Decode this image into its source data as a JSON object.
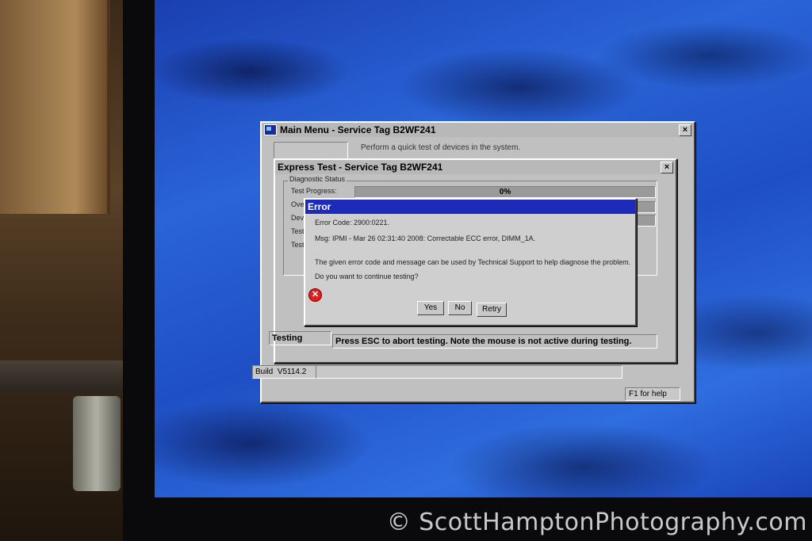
{
  "main_menu": {
    "title": "Main Menu - Service Tag B2WF241",
    "close": "×",
    "description": "Perform a quick test of devices in the system.",
    "status_left": "Build",
    "build_version": "V5114.2",
    "help_hint": "F1 for help"
  },
  "express_test": {
    "title": "Express Test - Service Tag B2WF241",
    "close": "×",
    "group_label": "Diagnostic Status",
    "rows": [
      "Test Progress:",
      "Ove",
      "Dev",
      "Test",
      "Test"
    ],
    "progress_text": "0%",
    "progress": 0,
    "status": "Testing",
    "hint": "Press ESC to abort testing.  Note the mouse is not active during testing."
  },
  "error_dialog": {
    "title": "Error",
    "error_code": "Error Code: 2900:0221.",
    "message": "Msg: IPMI - Mar 26 02:31:40 2008: Correctable ECC error, DIMM_1A.",
    "info": "The given error code and message can be used by Technical Support to help diagnose the problem.",
    "question": "Do you want to continue testing?",
    "buttons": {
      "yes": "Yes",
      "no": "No",
      "retry": "Retry"
    },
    "icon": "error-icon"
  },
  "watermark": "© ScottHamptonPhotography.com"
}
